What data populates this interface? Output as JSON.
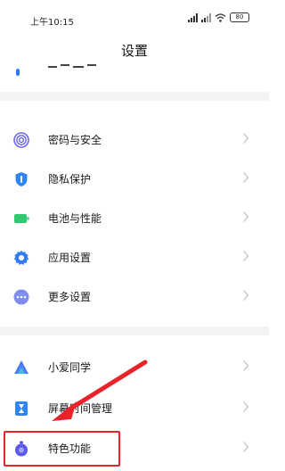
{
  "status": {
    "time": "上午10:15",
    "battery": "80"
  },
  "header": {
    "title": "设置"
  },
  "items": [
    {
      "label": "密码与安全",
      "icon": "fingerprint-icon",
      "color": "#6b65e8"
    },
    {
      "label": "隐私保护",
      "icon": "privacy-shield-icon",
      "color": "#2f86f6"
    },
    {
      "label": "电池与性能",
      "icon": "battery-icon",
      "color": "#2fc86e"
    },
    {
      "label": "应用设置",
      "icon": "gear-icon",
      "color": "#2f7ff0"
    },
    {
      "label": "更多设置",
      "icon": "more-dots-icon",
      "color": "#7f8cf0"
    },
    {
      "label": "小爱同学",
      "icon": "xiaoai-icon",
      "color": "#4a7df5"
    },
    {
      "label": "屏幕时间管理",
      "icon": "hourglass-icon",
      "color": "#2f86f6"
    },
    {
      "label": "特色功能",
      "icon": "special-feature-icon",
      "color": "#5d59e8"
    }
  ],
  "colors": {
    "highlight": "#e8242a",
    "section_gap": "#f4f4f4"
  }
}
